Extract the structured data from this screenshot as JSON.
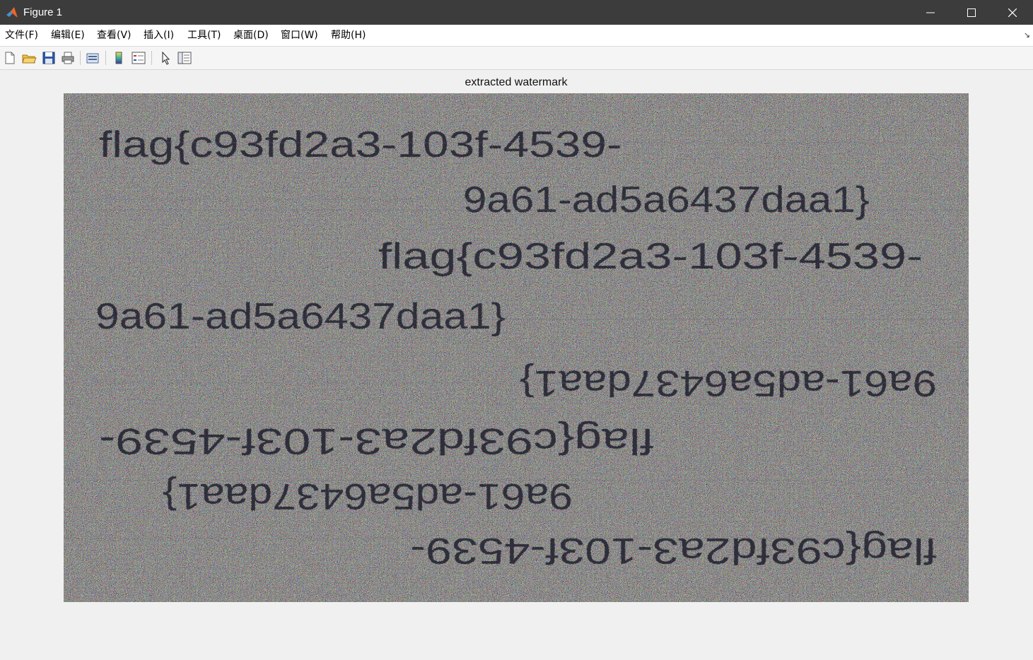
{
  "window": {
    "title": "Figure 1",
    "minimize_icon": "minimize-icon",
    "maximize_icon": "maximize-icon",
    "close_icon": "close-icon"
  },
  "menu": [
    "文件(F)",
    "编辑(E)",
    "查看(V)",
    "插入(I)",
    "工具(T)",
    "桌面(D)",
    "窗口(W)",
    "帮助(H)"
  ],
  "toolbar": {
    "icons": [
      "new-figure-icon",
      "open-file-icon",
      "save-icon",
      "print-icon",
      "link-plot-icon",
      "insert-colorbar-icon",
      "insert-legend-icon",
      "edit-plot-icon",
      "property-inspector-icon"
    ]
  },
  "axes": {
    "title": "extracted watermark",
    "watermark_lines": [
      "flag{c93fd2a3-103f-4539-",
      "9a61-ad5a6437daa1}",
      "flag{c93fd2a3-103f-4539-",
      "9a61-ad5a6437daa1}",
      "9a61-ad5a6437daa1}",
      "flag{c93fd2a3-103f-4539-",
      "9a61-ad5a6437daa1}",
      "flag{c93fd2a3-103f-4539-"
    ]
  },
  "colors": {
    "titlebar": "#3c3c3c",
    "figure_bg": "#f0f0f0",
    "text": "#1a1a2a"
  }
}
